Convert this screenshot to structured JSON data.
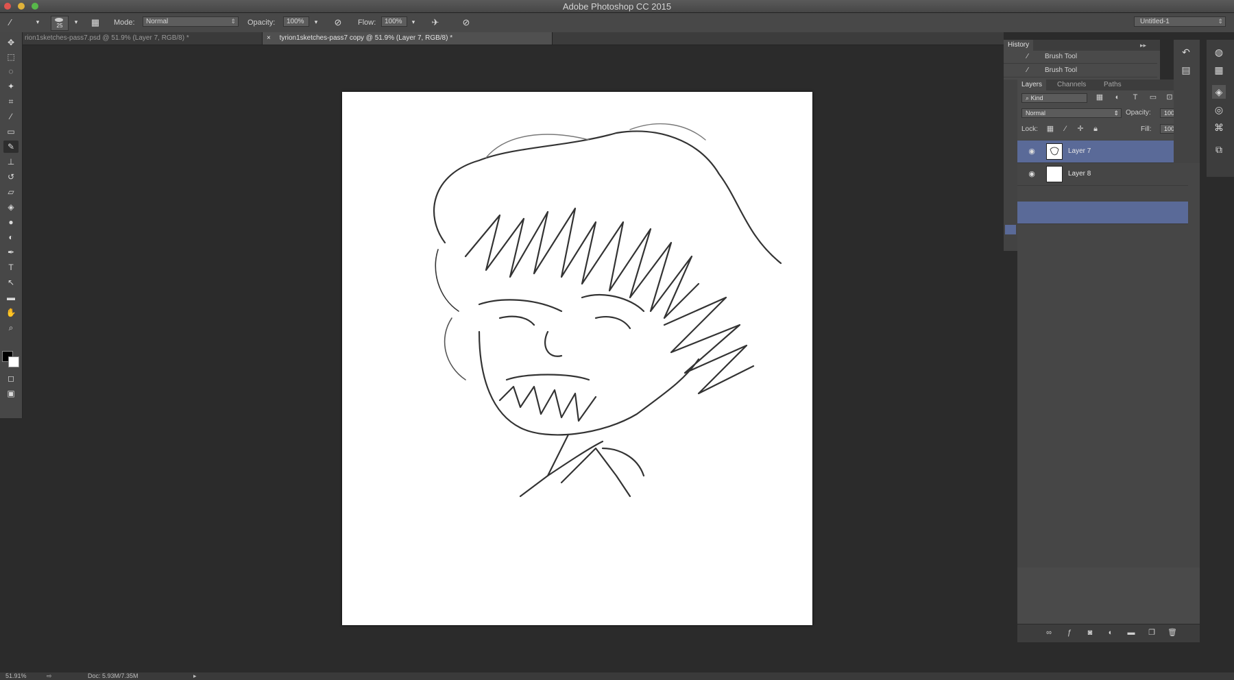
{
  "window": {
    "title": "Adobe Photoshop CC 2015",
    "workspace": "Untitled-1"
  },
  "options_bar": {
    "brush_size": "25",
    "mode_label": "Mode:",
    "mode_value": "Normal",
    "opacity_label": "Opacity:",
    "opacity_value": "100%",
    "flow_label": "Flow:",
    "flow_value": "100%"
  },
  "tabs": [
    {
      "label": "rion1sketches-pass7.psd @ 51.9% (Layer 7, RGB/8) *"
    },
    {
      "close": "×",
      "label": "tyrion1sketches-pass7 copy @ 51.9% (Layer 7, RGB/8) *"
    }
  ],
  "history_panel": {
    "title": "History",
    "items": [
      {
        "label": "Brush Tool"
      },
      {
        "label": "Brush Tool"
      }
    ]
  },
  "layers_panel": {
    "tabs": [
      {
        "label": "Layers"
      },
      {
        "label": "Channels"
      },
      {
        "label": "Paths"
      }
    ],
    "filter_kind": "Kind",
    "blend_mode": "Normal",
    "opacity_label": "Opacity:",
    "opacity_value": "100%",
    "lock_label": "Lock:",
    "fill_label": "Fill:",
    "fill_value": "100%",
    "layers": [
      {
        "name": "Layer 7",
        "selected": true
      },
      {
        "name": "Layer 8",
        "selected": false
      }
    ]
  },
  "status_bar": {
    "zoom": "51.91%",
    "doc": "Doc: 5.93M/7.35M"
  }
}
